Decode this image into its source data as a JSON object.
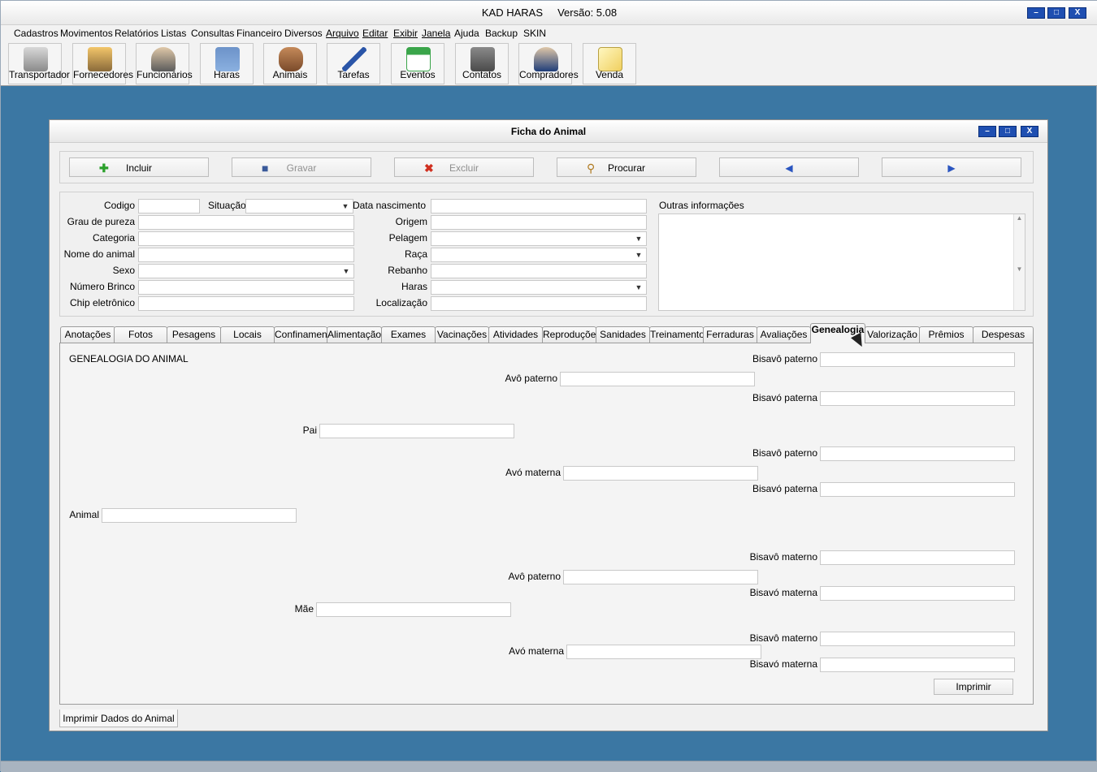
{
  "app": {
    "title": "KAD HARAS",
    "version": "Versão: 5.08"
  },
  "window_controls": {
    "minimize": "–",
    "maximize": "□",
    "close": "X"
  },
  "menu": [
    "Cadastros",
    "Movimentos",
    "Relatórios",
    "Listas",
    "Consultas",
    "Financeiro",
    "Diversos",
    "Arquivo",
    "Editar",
    "Exibir",
    "Janela",
    "Ajuda",
    "Backup",
    "SKIN"
  ],
  "toolbar": [
    {
      "label": "Transportador",
      "icon": "truck-icon"
    },
    {
      "label": "Fornecedores",
      "icon": "suppliers-icon"
    },
    {
      "label": "Funcionários",
      "icon": "employee-icon"
    },
    {
      "label": "Haras",
      "icon": "house-icon"
    },
    {
      "label": "Animais",
      "icon": "horse-head-icon"
    },
    {
      "label": "Tarefas",
      "icon": "pen-icon"
    },
    {
      "label": "Eventos",
      "icon": "calendar-icon"
    },
    {
      "label": "Contatos",
      "icon": "address-book-icon"
    },
    {
      "label": "Compradores",
      "icon": "buyer-icon"
    },
    {
      "label": "Venda",
      "icon": "notepad-icon"
    }
  ],
  "child": {
    "title": "Ficha do Animal",
    "actions": {
      "incluir": "Incluir",
      "gravar": "Gravar",
      "excluir": "Excluir",
      "procurar": "Procurar",
      "prev": "◀",
      "next": "▶"
    },
    "fields": {
      "codigo": "Codigo",
      "situacao": "Situação",
      "data_nascimento": "Data nascimento",
      "outras_informacoes": "Outras informações",
      "grau_pureza": "Grau de pureza",
      "origem": "Origem",
      "categoria": "Categoria",
      "pelagem": "Pelagem",
      "nome_animal": "Nome do animal",
      "raca": "Raça",
      "sexo": "Sexo",
      "rebanho": "Rebanho",
      "numero_brinco": "Número Brinco",
      "haras": "Haras",
      "chip": "Chip eletrônico",
      "localizacao": "Localização"
    },
    "tabs": [
      "Anotações",
      "Fotos",
      "Pesagens",
      "Locais",
      "Confinamen",
      "Alimentação",
      "Exames",
      "Vacinações",
      "Atividades",
      "Reproduções",
      "Sanidades",
      "Treinamentos",
      "Ferraduras",
      "Avaliações",
      "Genealogia",
      "Valorização",
      "Prêmios",
      "Despesas"
    ],
    "genealogy": {
      "heading": "GENEALOGIA DO ANIMAL",
      "animal": "Animal",
      "pai": "Pai",
      "mae": "Mãe",
      "avo_paterno": "Avô paterno",
      "avo_materna": "Avó materna",
      "bisavo_paterno": "Bisavô paterno",
      "bisavo_paterna": "Bisavó paterna",
      "bisavo_materno": "Bisavô materno",
      "bisavo_materna": "Bisavó materna",
      "imprimir": "Imprimir"
    },
    "bottom_tab": "Imprimir Dados do Animal"
  }
}
